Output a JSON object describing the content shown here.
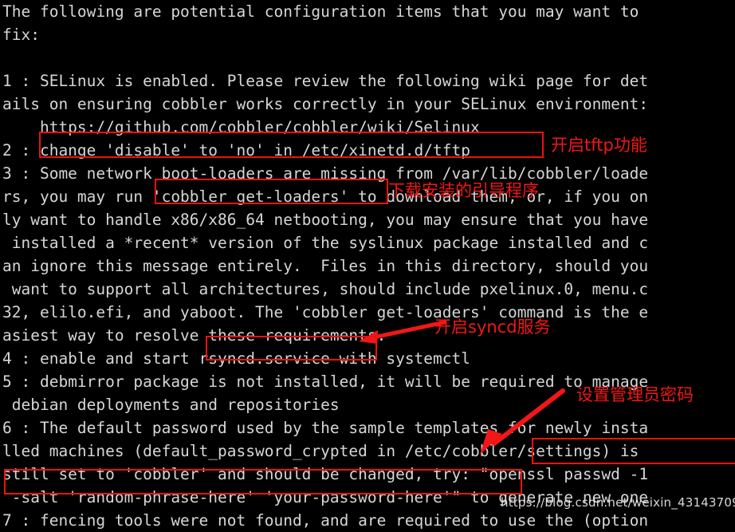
{
  "terminal": {
    "bg_color": "#000000",
    "fg_color": "#d6d6d6",
    "lines": [
      "The following are potential configuration items that you may want to",
      "fix:",
      "",
      "1 : SELinux is enabled. Please review the following wiki page for det",
      "ails on ensuring cobbler works correctly in your SELinux environment:",
      "    https://github.com/cobbler/cobbler/wiki/Selinux",
      "2 : change 'disable' to 'no' in /etc/xinetd.d/tftp",
      "3 : Some network boot-loaders are missing from /var/lib/cobbler/loade",
      "rs, you may run 'cobbler get-loaders' to download them, or, if you on",
      "ly want to handle x86/x86_64 netbooting, you may ensure that you have",
      " installed a *recent* version of the syslinux package installed and c",
      "an ignore this message entirely.  Files in this directory, should you",
      " want to support all architectures, should include pxelinux.0, menu.c",
      "32, elilo.efi, and yaboot. The 'cobbler get-loaders' command is the e",
      "asiest way to resolve these requirements.",
      "4 : enable and start rsyncd.service with systemctl",
      "5 : debmirror package is not installed, it will be required to manage",
      " debian deployments and repositories",
      "6 : The default password used by the sample templates for newly insta",
      "lled machines (default_password_crypted in /etc/cobbler/settings) is",
      "still set to 'cobbler' and should be changed, try: \"openssl passwd -1",
      " -salt 'random-phrase-here' 'your-password-here'\" to generate new one",
      "7 : fencing tools were not found, and are required to use the (option"
    ]
  },
  "annotations": {
    "accent_color": "#f21717",
    "labels": [
      {
        "id": "tftp",
        "text": "开启tftp功能"
      },
      {
        "id": "loaders",
        "text": "下载安装的引导程序"
      },
      {
        "id": "rsyncd",
        "text": "开启syncd服务"
      },
      {
        "id": "password",
        "text": "设置管理员密码"
      }
    ],
    "highlight_boxes": [
      {
        "id": "box-tftp",
        "content": "change 'disable' to 'no' in /etc/xinetd.d/tftp"
      },
      {
        "id": "box-get-loaders",
        "content": "'cobbler get-loaders'"
      },
      {
        "id": "box-rsyncd",
        "content": "rsyncd.service"
      },
      {
        "id": "box-openssl",
        "content": "\"openssl passwd -1"
      },
      {
        "id": "box-salt",
        "content": "-salt 'random-phrase-here' 'your-password-here'\""
      }
    ]
  },
  "watermark": {
    "line1": "https://blog.csdn.net/weixin_43143709"
  }
}
